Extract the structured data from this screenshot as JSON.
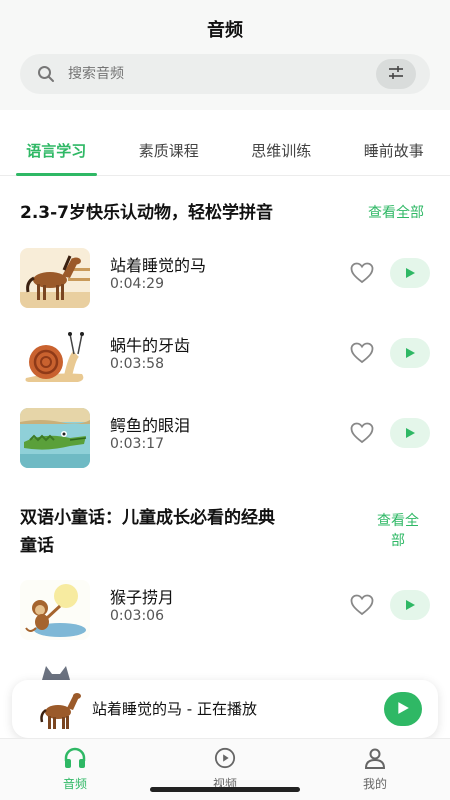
{
  "page": {
    "title": "音频"
  },
  "search": {
    "placeholder": "搜索音频"
  },
  "tabs": [
    {
      "label": "语言学习",
      "active": true
    },
    {
      "label": "素质课程",
      "active": false
    },
    {
      "label": "思维训练",
      "active": false
    },
    {
      "label": "睡前故事",
      "active": false
    }
  ],
  "sections": [
    {
      "title": "2.3-7岁快乐认动物，轻松学拼音",
      "see_all": "查看全部",
      "items": [
        {
          "title": "站着睡觉的马",
          "duration": "0:04:29",
          "thumb": "horse"
        },
        {
          "title": "蜗牛的牙齿",
          "duration": "0:03:58",
          "thumb": "snail"
        },
        {
          "title": "鳄鱼的眼泪",
          "duration": "0:03:17",
          "thumb": "crocodile"
        }
      ]
    },
    {
      "title_line1": "双语小童话：儿童成长必看的经典",
      "title_line2": "童话",
      "see_all_line1": "查看全",
      "see_all_line2": "部",
      "items": [
        {
          "title": "猴子捞月",
          "duration": "0:03:06",
          "thumb": "monkey"
        }
      ]
    }
  ],
  "now_playing": {
    "text": "站着睡觉的马 - 正在播放"
  },
  "bottom_nav": [
    {
      "label": "音频",
      "icon": "headphones-icon",
      "active": true
    },
    {
      "label": "视频",
      "icon": "play-circle-icon",
      "active": false
    },
    {
      "label": "我的",
      "icon": "user-icon",
      "active": false
    }
  ],
  "colors": {
    "accent": "#2fb865",
    "accent_light": "#e4f6ea"
  }
}
